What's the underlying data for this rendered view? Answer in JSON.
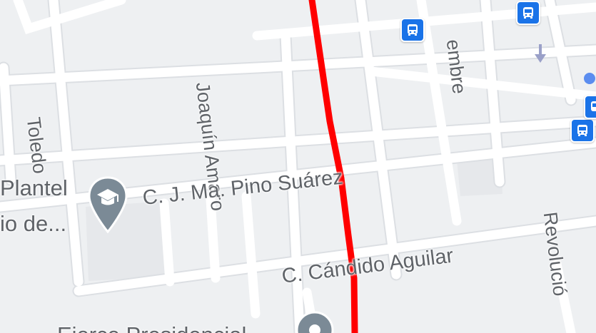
{
  "map": {
    "streets": {
      "joaquin_amaro": "Joaquín Amaro",
      "toledo": "Toledo",
      "embre": "embre",
      "pino_suarez": "C. J. Ma. Pino Suárez",
      "candido_aguilar": "C. Cándido Aguilar",
      "revolucion": "Revolució"
    },
    "pois": {
      "plantel_line1": "Plantel",
      "plantel_line2": "io de...",
      "bottom_place": "Ejerce Presidencial"
    },
    "colors": {
      "route": "#ff0000",
      "transit": "#1a73e8",
      "poi_pin": "#7b8a96",
      "background": "#eef0f2",
      "road": "#ffffff",
      "block": "#e8eaed"
    },
    "icons": [
      "bus-icon",
      "education-pin-icon",
      "place-pin-icon",
      "one-way-arrow-icon",
      "location-dot-icon"
    ]
  }
}
